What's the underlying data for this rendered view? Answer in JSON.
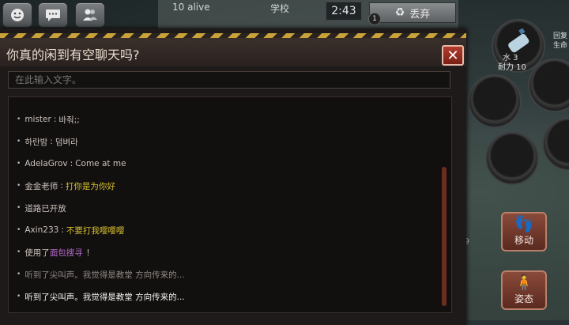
{
  "hud": {
    "players_alive": "10 alive",
    "location": "学校",
    "timer": "2:43",
    "discard_label": "丢弃",
    "discard_count": "1",
    "item_name": "水 3",
    "item_durability": "耐力 10",
    "item_side_label": "回复\n生命",
    "move_label": "移动",
    "stance_label": "姿态",
    "slot_number": "19"
  },
  "dialog": {
    "title": "你真的闲到有空聊天吗?",
    "input_placeholder": "在此输入文字。",
    "messages": [
      {
        "user": "mister",
        "text": "바줘;;",
        "style": "normal"
      },
      {
        "user": "하란밤",
        "text": "덤벼라",
        "style": "normal"
      },
      {
        "user": "AdelaGrov",
        "text": "Come at me",
        "style": "normal"
      },
      {
        "user": "金金老师",
        "text": "打你是为你好",
        "style": "yellow"
      },
      {
        "system": "道路已开放",
        "style": "normal"
      },
      {
        "user": "Axin233",
        "text": "不要打我嘤嘤嘤",
        "style": "yellow"
      },
      {
        "system_prefix": "使用了",
        "item": "面包搜寻",
        "system_suffix": "！",
        "style": "purple"
      },
      {
        "system": "听到了尖叫声。我觉得是教堂 方向传来的...",
        "style": "dim"
      },
      {
        "system": "听到了尖叫声。我觉得是教堂 方向传来的...",
        "style": "bright"
      }
    ]
  },
  "colors": {
    "accent_yellow": "#d7c02e",
    "accent_purple": "#b36ac9",
    "close_red": "#b23d2d"
  },
  "icons": {
    "emoji": "smiley-icon",
    "chat": "chat-bubble-icon",
    "people": "people-icon",
    "recycle": "recycle-icon",
    "close": "close-icon",
    "footprints": "footprints-icon",
    "stance": "person-stance-icon"
  }
}
